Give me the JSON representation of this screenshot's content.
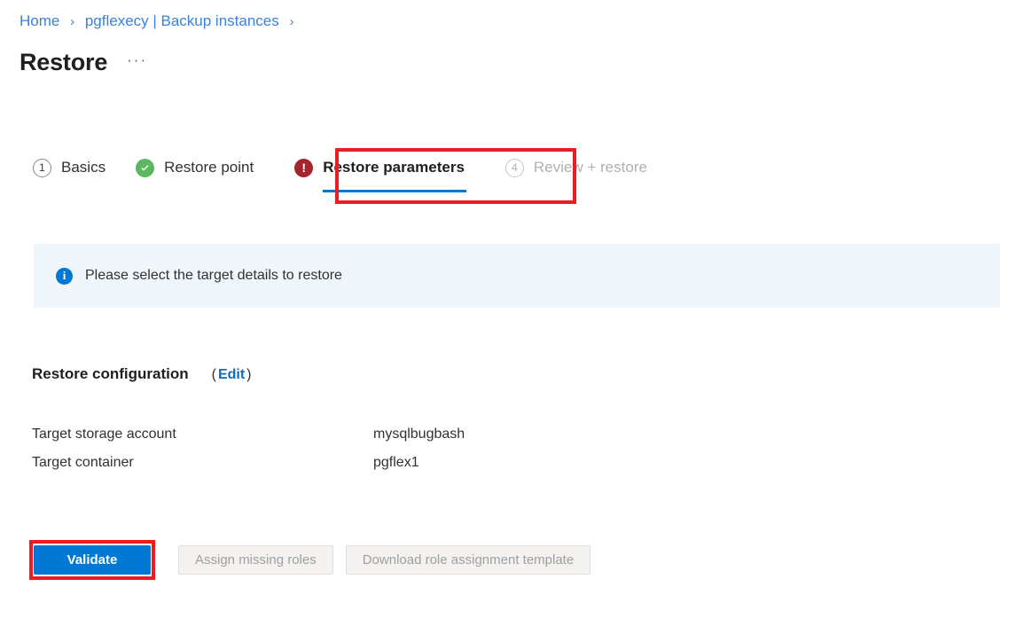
{
  "breadcrumb": {
    "items": [
      {
        "label": "Home"
      },
      {
        "label": "pgflexecy | Backup instances"
      }
    ],
    "separator": "›"
  },
  "header": {
    "title": "Restore",
    "more_menu": "···"
  },
  "wizard": {
    "steps": [
      {
        "label": "Basics",
        "badge": "1",
        "state": "incomplete"
      },
      {
        "label": "Restore point",
        "badge": "check-icon",
        "state": "complete"
      },
      {
        "label": "Restore parameters",
        "badge": "error-icon",
        "state": "active-error"
      },
      {
        "label": "Review + restore",
        "badge": "4",
        "state": "disabled"
      }
    ],
    "error_badge_glyph": "!",
    "active_underline_color": "#0078d4",
    "complete_color": "#5cb860",
    "error_color": "#a4262c"
  },
  "info_banner": {
    "icon": "info-icon",
    "icon_glyph": "i",
    "message": "Please select the target details to restore",
    "background": "#eff6fc",
    "icon_color": "#0078d4"
  },
  "restore_configuration": {
    "title": "Restore configuration",
    "paren_open": "(",
    "edit_label": "Edit",
    "paren_close": ")",
    "rows": [
      {
        "key": "Target storage account",
        "value": "mysqlbugbash"
      },
      {
        "key": "Target container",
        "value": "pgflex1"
      }
    ]
  },
  "actions": {
    "validate_label": "Validate",
    "assign_roles_label": "Assign missing roles",
    "download_template_label": "Download role assignment template",
    "primary_color": "#0078d4"
  },
  "annotations": {
    "color": "#ed1c24",
    "highlighted": [
      "Restore parameters",
      "Validate"
    ]
  }
}
